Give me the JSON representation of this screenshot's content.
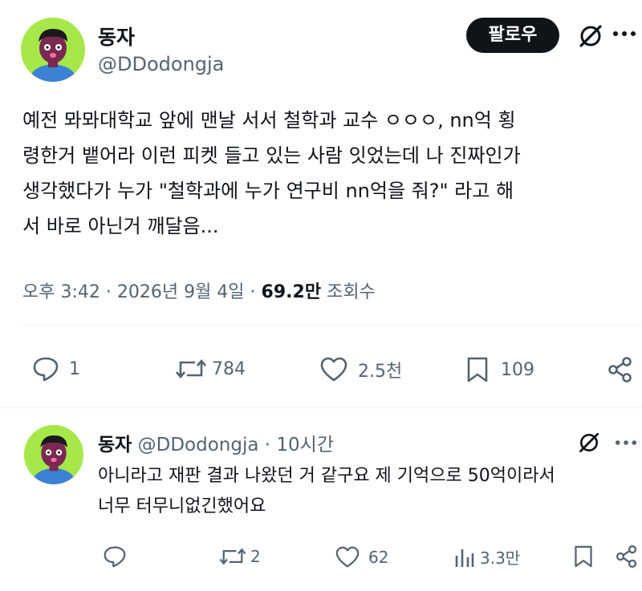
{
  "main_post": {
    "display_name": "동자",
    "handle": "@DDodongja",
    "follow_label": "팔로우",
    "body_lines": [
      "예전 뫄뫄대학교 앞에 맨날 서서 철학과 교수 ㅇㅇㅇ, nn억 횡",
      "령한거 뱉어라 이런 피켓 들고 있는 사람 잇었는데 나 진짜인가",
      "생각했다가 누가 \"철학과에 누가 연구비 nn억을 줘?\" 라고 해",
      "서 바로 아닌거 깨달음..."
    ],
    "timestamp": "오후 3:42 · 2026년 9월 4일 ·",
    "views_count": "69.2만",
    "views_label": "조회수",
    "actions": {
      "replies": "1",
      "reposts": "784",
      "likes": "2.5천",
      "bookmarks": "109"
    }
  },
  "reply_post": {
    "display_name": "동자",
    "handle": "@DDodongja",
    "time": "· 10시간",
    "body_lines": [
      "아니라고 재판 결과 나왔던 거 같구요 제 기억으로 50억이라서",
      "너무 터무니없긴했어요"
    ],
    "actions": {
      "replies": "",
      "reposts": "2",
      "likes": "62",
      "views": "3.3만"
    }
  },
  "icons": {
    "more": "more-horizontal-icon",
    "grok": "grok-slash-icon",
    "reply": "speech-bubble-icon",
    "repost": "repost-icon",
    "like": "heart-icon",
    "bookmark": "bookmark-icon",
    "share": "share-icon",
    "views": "bar-chart-icon"
  },
  "colors": {
    "text": "#0f1419",
    "muted": "#536471",
    "avatar_bg": "#a6e84a",
    "follow_bg": "#0f1419"
  }
}
